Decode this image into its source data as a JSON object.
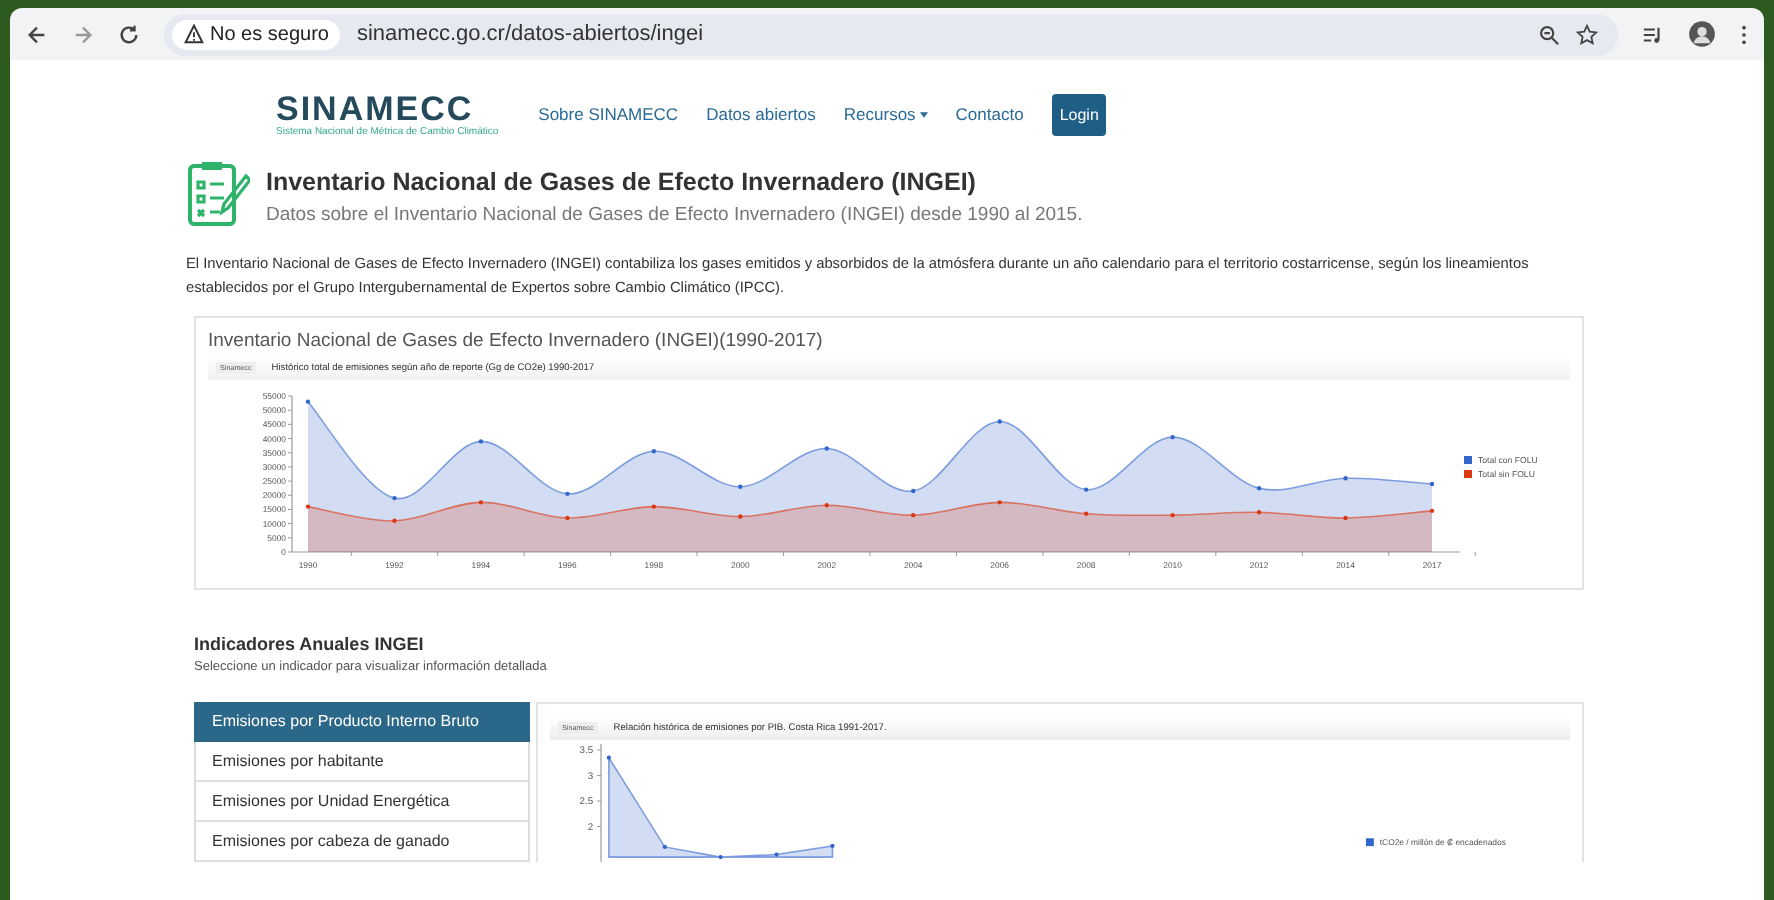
{
  "browser": {
    "security": "No es seguro",
    "url": "sinamecc.go.cr/datos-abiertos/ingei"
  },
  "nav": {
    "logo": "SINAMECC",
    "tagline": "Sistema Nacional de Métrica de Cambio Climático",
    "items": [
      {
        "label": "Sobre SINAMECC",
        "kind": "link"
      },
      {
        "label": "Datos abiertos",
        "kind": "link"
      },
      {
        "label": "Recursos",
        "kind": "dropdown"
      },
      {
        "label": "Contacto",
        "kind": "link"
      },
      {
        "label": "Login",
        "kind": "button"
      }
    ]
  },
  "header": {
    "title": "Inventario Nacional de Gases de Efecto Invernadero (INGEI)",
    "subtitle": "Datos sobre el Inventario Nacional de Gases de Efecto Invernadero (INGEI) desde 1990 al 2015."
  },
  "intro": "El Inventario Nacional de Gases de Efecto Invernadero (INGEI) contabiliza los gases emitidos y absorbidos de la atmósfera durante un año calendario para el territorio costarricense, según los lineamientos establecidos por el Grupo Intergubernamental de Expertos sobre Cambio Climático (IPCC).",
  "main_chart": {
    "heading": "Inventario Nacional de Gases de Efecto Invernadero (INGEI)(1990-2017)",
    "tag": "Sinamecc",
    "chart_data": {
      "type": "area",
      "title": "Histórico total de emisiones según año de reporte (Gg de CO2e) 1990-2017",
      "categories": [
        "1990",
        "1992",
        "1994",
        "1996",
        "1998",
        "2000",
        "2002",
        "2004",
        "2006",
        "2008",
        "2010",
        "2012",
        "2014",
        "2017"
      ],
      "series": [
        {
          "name": "Total con FOLU",
          "color": "#3366cc",
          "values": [
            53000,
            19000,
            39000,
            20500,
            35500,
            23000,
            36500,
            21500,
            46000,
            22000,
            40500,
            22500,
            26000,
            24000
          ]
        },
        {
          "name": "Total sin FOLU",
          "color": "#dc3912",
          "values": [
            16000,
            11000,
            17500,
            12000,
            16000,
            12500,
            16500,
            13000,
            17500,
            13500,
            13000,
            14000,
            12000,
            14500
          ]
        }
      ],
      "ylim": [
        0,
        55000
      ],
      "yticks": [
        0,
        5000,
        10000,
        15000,
        20000,
        25000,
        30000,
        35000,
        40000,
        45000,
        50000,
        55000
      ],
      "legend": "right"
    }
  },
  "indicators": {
    "title": "Indicadores Anuales INGEI",
    "subtitle": "Seleccione un indicador para visualizar información detallada",
    "items": [
      {
        "label": "Emisiones por Producto Interno Bruto",
        "selected": true
      },
      {
        "label": "Emisiones por habitante",
        "selected": false
      },
      {
        "label": "Emisiones por Unidad Energética",
        "selected": false
      },
      {
        "label": "Emisiones por cabeza de ganado",
        "selected": false
      }
    ],
    "tag": "Sinamecc",
    "chart_data": {
      "type": "area",
      "title": "Relación histórica de emisiones por PIB. Costa Rica 1991-2017.",
      "categories": [
        null,
        null,
        null,
        null,
        null
      ],
      "series": [
        {
          "name": "tCO2e / millón de ₡ encadenados",
          "color": "#3366cc",
          "values": [
            3.35,
            1.6,
            1.4,
            1.45,
            1.62
          ]
        }
      ],
      "yticks": [
        2,
        2.5,
        3,
        3.5
      ],
      "ylim": [
        1.4,
        3.6
      ],
      "legend": "right"
    }
  }
}
